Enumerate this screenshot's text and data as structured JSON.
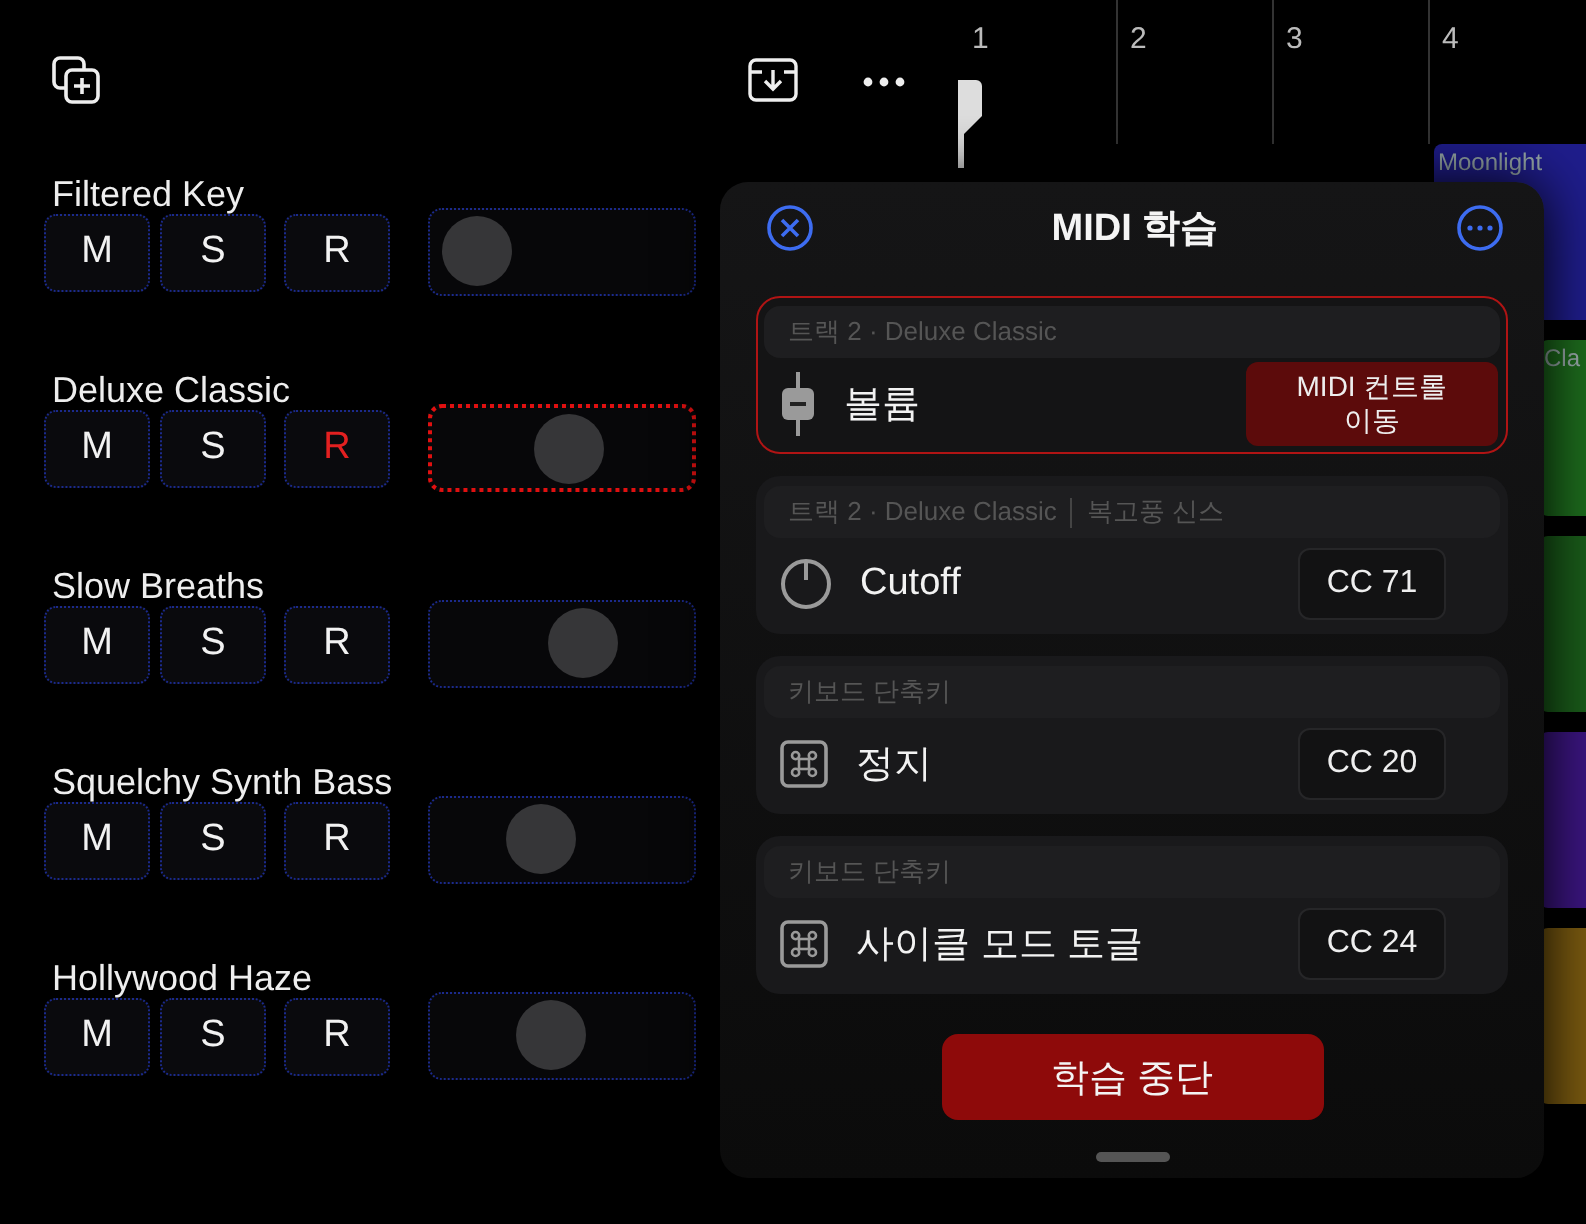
{
  "ruler": {
    "bars": [
      "1",
      "2",
      "3",
      "4"
    ]
  },
  "clips": [
    {
      "name": "Moonlight",
      "color": "#1f1d8c"
    },
    {
      "name": "Cla",
      "color": "#1d6b1d"
    },
    {
      "color": "#1a5c1a"
    },
    {
      "color": "#3b1580"
    },
    {
      "color": "#7a5a10"
    }
  ],
  "tracks": [
    {
      "name": "Filtered Key",
      "mute": "M",
      "solo": "S",
      "record": "R",
      "record_armed": false,
      "learn_selected": false,
      "level": 0.03
    },
    {
      "name": "Deluxe Classic",
      "mute": "M",
      "solo": "S",
      "record": "R",
      "record_armed": true,
      "learn_selected": true,
      "level": 0.56
    },
    {
      "name": "Slow Breaths",
      "mute": "M",
      "solo": "S",
      "record": "R",
      "record_armed": false,
      "learn_selected": false,
      "level": 0.64
    },
    {
      "name": "Squelchy Synth Bass",
      "mute": "M",
      "solo": "S",
      "record": "R",
      "record_armed": false,
      "learn_selected": false,
      "level": 0.4
    },
    {
      "name": "Hollywood Haze",
      "mute": "M",
      "solo": "S",
      "record": "R",
      "record_armed": false,
      "learn_selected": false,
      "level": 0.46
    }
  ],
  "midi_learn": {
    "title": "MIDI 학습",
    "assignments": [
      {
        "context": "트랙 2 · Deluxe Classic",
        "kind": "fader",
        "label": "볼륨",
        "control": "MIDI 컨트롤 이동",
        "learning": true
      },
      {
        "context": "트랙 2 · Deluxe Classic",
        "context_extra": "복고풍 신스",
        "kind": "knob",
        "label": "Cutoff",
        "control": "CC 71",
        "learning": false
      },
      {
        "context": "키보드 단축키",
        "kind": "command",
        "label": "정지",
        "control": "CC 20",
        "learning": false
      },
      {
        "context": "키보드 단축키",
        "kind": "command",
        "label": "사이클 모드 토글",
        "control": "CC 24",
        "learning": false
      }
    ],
    "stop_button": "학습 중단"
  }
}
